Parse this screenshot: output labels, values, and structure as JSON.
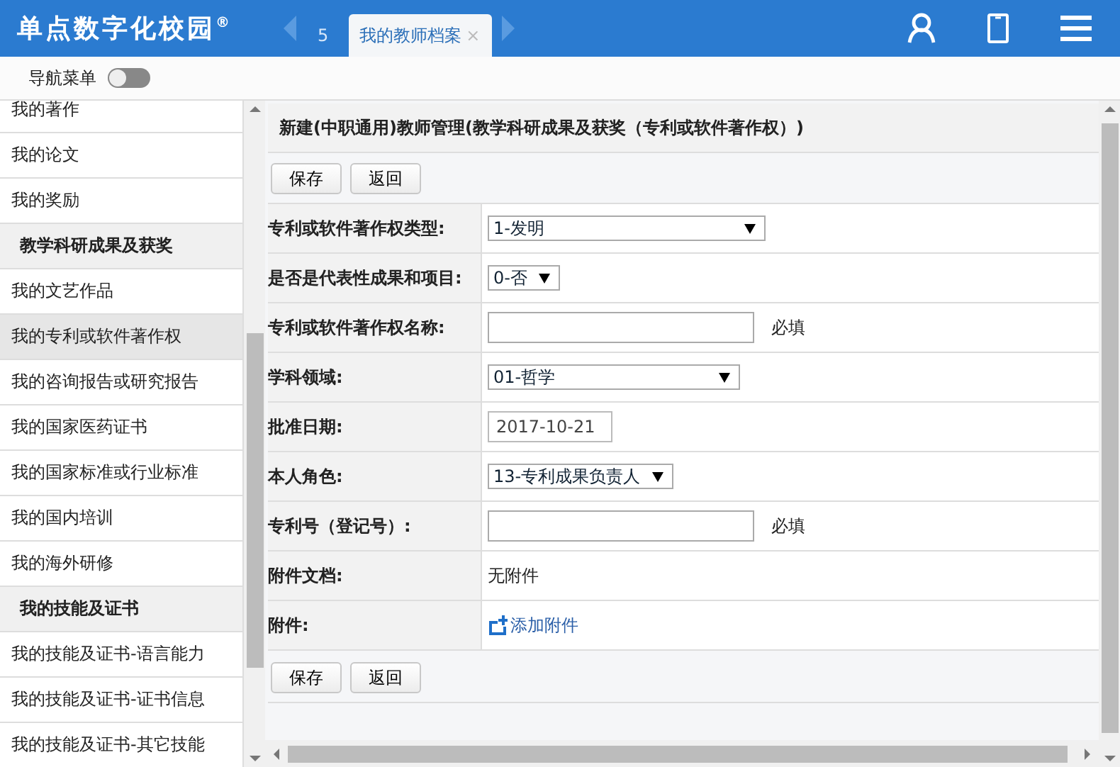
{
  "header": {
    "logo": "单点数字化校园",
    "logo_mark": "®",
    "tabs": [
      {
        "label": "5",
        "closable": false,
        "selected": false
      },
      {
        "label": "我的教师档案",
        "closable": true,
        "selected": true
      }
    ],
    "close_glyph": "×"
  },
  "toolbar": {
    "nav_label": "导航菜单",
    "nav_on": false
  },
  "sidebar": {
    "items": [
      {
        "kind": "item",
        "label": "我的著作",
        "selected": false
      },
      {
        "kind": "item",
        "label": "我的论文",
        "selected": false
      },
      {
        "kind": "item",
        "label": "我的奖励",
        "selected": false
      },
      {
        "kind": "heading",
        "label": "教学科研成果及获奖"
      },
      {
        "kind": "item",
        "label": "我的文艺作品",
        "selected": false
      },
      {
        "kind": "item",
        "label": "我的专利或软件著作权",
        "selected": true
      },
      {
        "kind": "item",
        "label": "我的咨询报告或研究报告",
        "selected": false
      },
      {
        "kind": "item",
        "label": "我的国家医药证书",
        "selected": false
      },
      {
        "kind": "item",
        "label": "我的国家标准或行业标准",
        "selected": false
      },
      {
        "kind": "item",
        "label": "我的国内培训",
        "selected": false
      },
      {
        "kind": "item",
        "label": "我的海外研修",
        "selected": false
      },
      {
        "kind": "heading",
        "label": "我的技能及证书"
      },
      {
        "kind": "item",
        "label": "我的技能及证书-语言能力",
        "selected": false
      },
      {
        "kind": "item",
        "label": "我的技能及证书-证书信息",
        "selected": false
      },
      {
        "kind": "item",
        "label": "我的技能及证书-其它技能",
        "selected": false
      }
    ]
  },
  "form": {
    "title": "新建(中职通用)教师管理(教学科研成果及获奖（专利或软件著作权）)",
    "buttons": [
      "保存",
      "返回"
    ],
    "fields": [
      {
        "label": "专利或软件著作权类型:",
        "kind": "select",
        "value": "1-发明"
      },
      {
        "label": "是否是代表性成果和项目:",
        "kind": "select",
        "value": "0-否"
      },
      {
        "label": "专利或软件著作权名称:",
        "kind": "input",
        "note": "必填"
      },
      {
        "label": "学科领域:",
        "kind": "select",
        "value": "01-哲学"
      },
      {
        "label": "批准日期:",
        "kind": "date",
        "value": "2017-10-21"
      },
      {
        "label": "本人角色:",
        "kind": "select",
        "value": "13-专利成果负责人"
      },
      {
        "label": "专利号（登记号）:",
        "kind": "input",
        "note": "必填"
      },
      {
        "label": "附件文档:",
        "kind": "text",
        "value": "无附件"
      },
      {
        "label": "附件:",
        "kind": "link",
        "value": "添加附件"
      }
    ],
    "bottom_buttons": [
      "保存",
      "返回"
    ]
  }
}
